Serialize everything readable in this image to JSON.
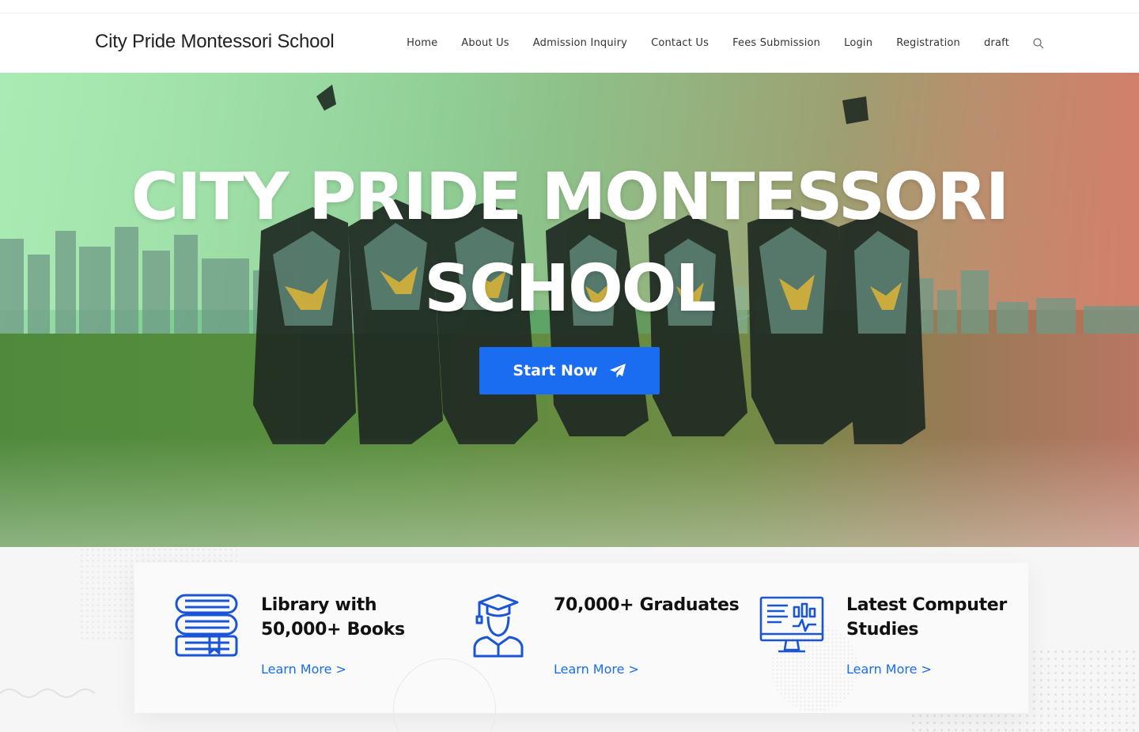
{
  "header": {
    "site_title": "City Pride Montessori School",
    "nav": [
      "Home",
      "About Us",
      "Admission Inquiry",
      "Contact Us",
      "Fees Submission",
      "Login",
      "Registration",
      "draft"
    ],
    "search_icon": "search-icon"
  },
  "hero": {
    "title_line1": "CITY PRIDE MONTESSORI",
    "title_line2": "SCHOOL",
    "cta_label": "Start Now",
    "cta_icon": "paper-plane-icon"
  },
  "features": [
    {
      "title": "Library with 50,000+ Books",
      "link": "Learn More >",
      "icon": "books-icon"
    },
    {
      "title": "70,000+ Graduates",
      "link": "Learn More >",
      "icon": "graduate-icon"
    },
    {
      "title": "Latest Computer Studies",
      "link": "Learn More >",
      "icon": "computer-monitor-icon"
    }
  ],
  "colors": {
    "accent": "#1a6cf0",
    "heading": "#111111",
    "white": "#ffffff"
  }
}
